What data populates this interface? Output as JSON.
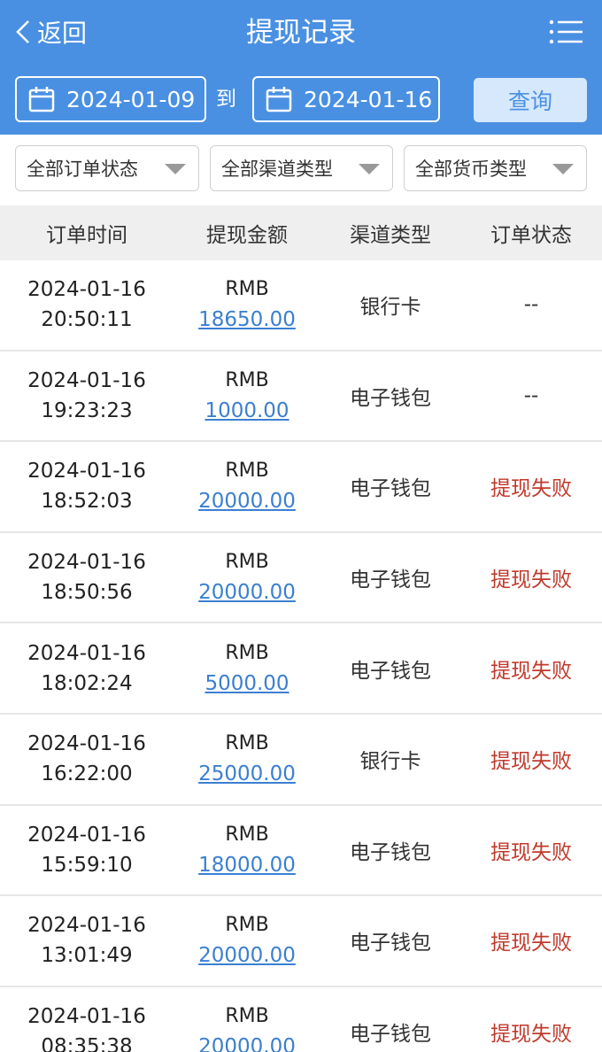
{
  "header": {
    "back_label": "返回",
    "title": "提现记录"
  },
  "date_filter": {
    "start": "2024-01-09",
    "to": "到",
    "end": "2024-01-16",
    "query_label": "查询"
  },
  "filters": {
    "order_status": "全部订单状态",
    "channel_type": "全部渠道类型",
    "currency_type": "全部货币类型"
  },
  "table": {
    "headers": [
      "订单时间",
      "提现金额",
      "渠道类型",
      "订单状态"
    ],
    "rows": [
      {
        "date": "2024-01-16",
        "time": "20:50:11",
        "currency": "RMB",
        "amount": "18650.00",
        "channel": "银行卡",
        "status": "--"
      },
      {
        "date": "2024-01-16",
        "time": "19:23:23",
        "currency": "RMB",
        "amount": "1000.00",
        "channel": "电子钱包",
        "status": "--"
      },
      {
        "date": "2024-01-16",
        "time": "18:52:03",
        "currency": "RMB",
        "amount": "20000.00",
        "channel": "电子钱包",
        "status": "提现失败"
      },
      {
        "date": "2024-01-16",
        "time": "18:50:56",
        "currency": "RMB",
        "amount": "20000.00",
        "channel": "电子钱包",
        "status": "提现失败"
      },
      {
        "date": "2024-01-16",
        "time": "18:02:24",
        "currency": "RMB",
        "amount": "5000.00",
        "channel": "电子钱包",
        "status": "提现失败"
      },
      {
        "date": "2024-01-16",
        "time": "16:22:00",
        "currency": "RMB",
        "amount": "25000.00",
        "channel": "银行卡",
        "status": "提现失败"
      },
      {
        "date": "2024-01-16",
        "time": "15:59:10",
        "currency": "RMB",
        "amount": "18000.00",
        "channel": "电子钱包",
        "status": "提现失败"
      },
      {
        "date": "2024-01-16",
        "time": "13:01:49",
        "currency": "RMB",
        "amount": "20000.00",
        "channel": "电子钱包",
        "status": "提现失败"
      },
      {
        "date": "2024-01-16",
        "time": "08:35:38",
        "currency": "RMB",
        "amount": "20000.00",
        "channel": "电子钱包",
        "status": "提现失败"
      }
    ]
  },
  "colors": {
    "header_bg": "#4a90e2",
    "link": "#3b7fd1",
    "fail": "#c0392b"
  },
  "icons": {
    "back": "chevron-left-icon",
    "menu": "menu-icon",
    "calendar": "calendar-icon",
    "dropdown": "caret-down-icon"
  }
}
